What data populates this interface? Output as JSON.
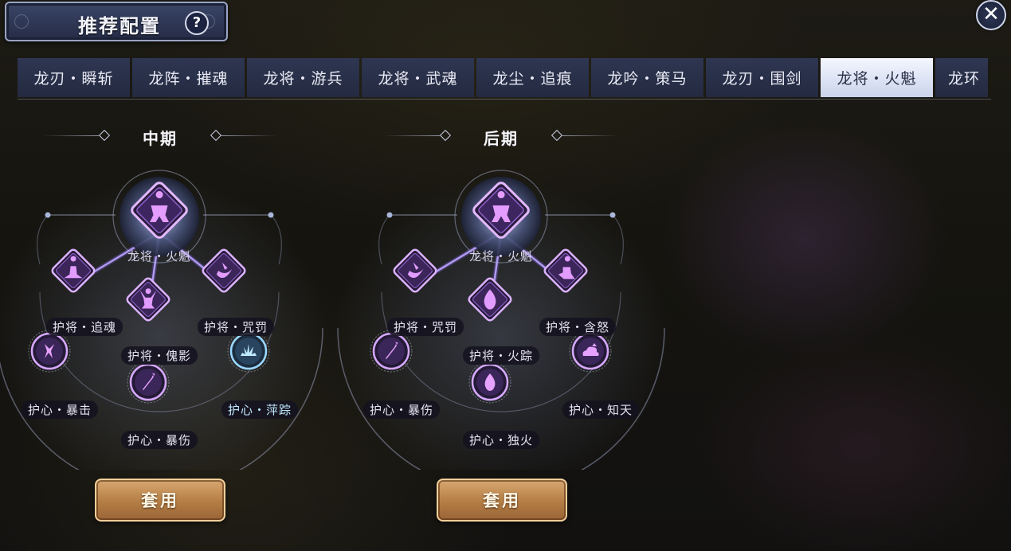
{
  "header": {
    "title": "推荐配置",
    "help_label": "?",
    "close_label": "✕"
  },
  "tabs": [
    {
      "label": "龙刃・瞬斩",
      "active": false
    },
    {
      "label": "龙阵・摧魂",
      "active": false
    },
    {
      "label": "龙将・游兵",
      "active": false
    },
    {
      "label": "龙将・武魂",
      "active": false
    },
    {
      "label": "龙尘・追痕",
      "active": false
    },
    {
      "label": "龙吟・策马",
      "active": false
    },
    {
      "label": "龙刃・围剑",
      "active": false
    },
    {
      "label": "龙将・火魁",
      "active": true
    },
    {
      "label": "龙环",
      "active": false
    }
  ],
  "panels": [
    {
      "stage": "中期",
      "core": {
        "label": "龙将・火魁",
        "icon": "crouching-figure-icon"
      },
      "guards": [
        {
          "label": "护将・追魂",
          "icon": "meditating-figure-icon"
        },
        {
          "label": "护将・傀影",
          "icon": "arms-raised-figure-icon"
        },
        {
          "label": "护将・咒罚",
          "icon": "crescent-strike-icon"
        }
      ],
      "hearts": [
        {
          "label": "护心・暴击",
          "icon": "sparks-icon",
          "tint": "purple"
        },
        {
          "label": "护心・暴伤",
          "icon": "sword-up-icon",
          "tint": "purple"
        },
        {
          "label": "护心・萍踪",
          "icon": "splash-icon",
          "tint": "blue"
        }
      ],
      "apply_label": "套用"
    },
    {
      "stage": "后期",
      "core": {
        "label": "龙将・火魁",
        "icon": "crouching-figure-icon"
      },
      "guards": [
        {
          "label": "护将・咒罚",
          "icon": "crescent-strike-icon"
        },
        {
          "label": "护将・火踪",
          "icon": "flame-icon"
        },
        {
          "label": "护将・含怒",
          "icon": "kneeling-figure-icon"
        }
      ],
      "hearts": [
        {
          "label": "护心・暴伤",
          "icon": "sword-up-icon",
          "tint": "purple"
        },
        {
          "label": "护心・独火",
          "icon": "flame-icon",
          "tint": "purple"
        },
        {
          "label": "护心・知天",
          "icon": "cloud-up-icon",
          "tint": "purple"
        }
      ],
      "apply_label": "套用"
    }
  ],
  "colors": {
    "accent_purple": "#c77bff",
    "accent_blue": "#8fd4ff",
    "button_gold": "#c48d55"
  }
}
